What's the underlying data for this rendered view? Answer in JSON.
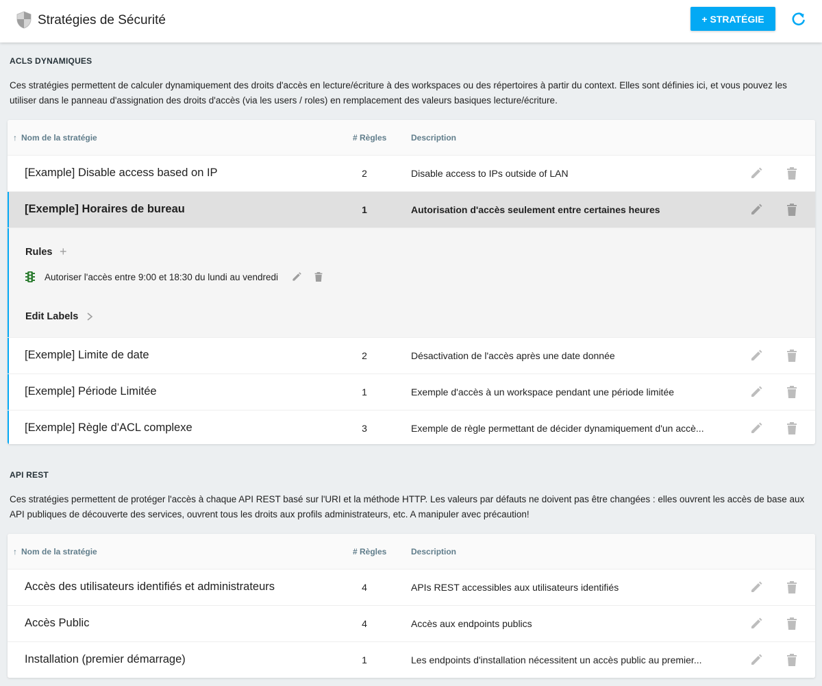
{
  "header": {
    "title": "Stratégies de Sécurité",
    "add_label": "+ STRATÉGIE",
    "accent_color": "#03a9f4"
  },
  "acls": {
    "title": "ACLS DYNAMIQUES",
    "description": "Ces stratégies permettent de calculer dynamiquement des droits d'accès en lecture/écriture à des workspaces ou des répertoires à partir du context. Elles sont définies ici, et vous pouvez les utiliser dans le panneau d'assignation des droits d'accès (via les users / roles) en remplacement des valeurs basiques lecture/écriture.",
    "columns": {
      "sort_arrow": "↑",
      "name": "Nom de la stratégie",
      "rules": "# Règles",
      "description": "Description"
    },
    "rows": [
      {
        "name": "[Example] Disable access based on IP",
        "rules": "2",
        "description": "Disable access to IPs outside of LAN"
      },
      {
        "name": "[Exemple] Horaires de bureau",
        "rules": "1",
        "description": "Autorisation d'accès seulement entre certaines heures"
      },
      {
        "name": "[Exemple] Limite de date",
        "rules": "2",
        "description": "Désactivation de l'accès après une date donnée"
      },
      {
        "name": "[Exemple] Période Limitée",
        "rules": "1",
        "description": "Exemple d'accès à un workspace pendant une période limitée"
      },
      {
        "name": "[Exemple] Règle d'ACL complexe",
        "rules": "3",
        "description": "Exemple de règle permettant de décider dynamiquement d'un accè..."
      }
    ],
    "expanded": {
      "rules_title": "Rules",
      "add_symbol": "+",
      "rule_label": "Autoriser l'accès entre 9:00 et 18:30 du lundi au vendredi",
      "labels_title": "Edit Labels"
    }
  },
  "api": {
    "title": "API REST",
    "description": "Ces stratégies permettent de protéger l'accès à chaque API REST basé sur l'URI et la méthode HTTP. Les valeurs par défauts ne doivent pas être changées : elles ouvrent les accès de base aux API publiques de découverte des services, ouvrent tous les droits aux profils administrateurs, etc. A manipuler avec précaution!",
    "columns": {
      "sort_arrow": "↑",
      "name": "Nom de la stratégie",
      "rules": "# Règles",
      "description": "Description"
    },
    "rows": [
      {
        "name": "Accès des utilisateurs identifiés et administrateurs",
        "rules": "4",
        "description": "APIs REST accessibles aux utilisateurs identifiés"
      },
      {
        "name": "Accès Public",
        "rules": "4",
        "description": "Accès aux endpoints publics"
      },
      {
        "name": "Installation (premier démarrage)",
        "rules": "1",
        "description": "Les endpoints d'installation nécessitent un accès public au premier..."
      }
    ]
  }
}
